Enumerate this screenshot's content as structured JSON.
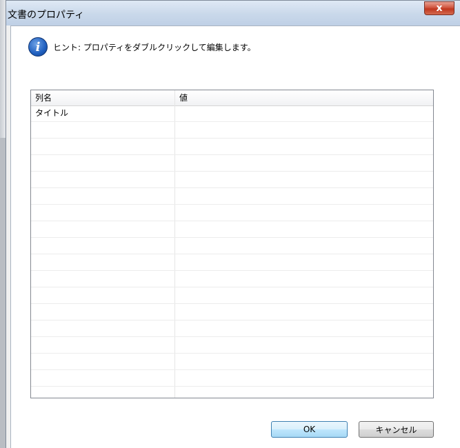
{
  "window": {
    "title": "文書のプロパティ",
    "close_label": "x"
  },
  "hint": {
    "icon": "info-icon",
    "text": "ヒント: プロパティをダブルクリックして編集します。"
  },
  "table": {
    "columns": [
      "列名",
      "値"
    ],
    "rows": [
      {
        "name": "タイトル",
        "value": ""
      },
      {
        "name": "",
        "value": ""
      },
      {
        "name": "",
        "value": ""
      },
      {
        "name": "",
        "value": ""
      },
      {
        "name": "",
        "value": ""
      },
      {
        "name": "",
        "value": ""
      },
      {
        "name": "",
        "value": ""
      },
      {
        "name": "",
        "value": ""
      },
      {
        "name": "",
        "value": ""
      },
      {
        "name": "",
        "value": ""
      },
      {
        "name": "",
        "value": ""
      },
      {
        "name": "",
        "value": ""
      },
      {
        "name": "",
        "value": ""
      },
      {
        "name": "",
        "value": ""
      },
      {
        "name": "",
        "value": ""
      },
      {
        "name": "",
        "value": ""
      },
      {
        "name": "",
        "value": ""
      },
      {
        "name": "",
        "value": ""
      }
    ]
  },
  "buttons": {
    "ok": "OK",
    "cancel": "キャンセル"
  },
  "colors": {
    "close_button": "#c0371f",
    "info_icon": "#1f5fbf",
    "ok_border": "#3c7fb1"
  }
}
